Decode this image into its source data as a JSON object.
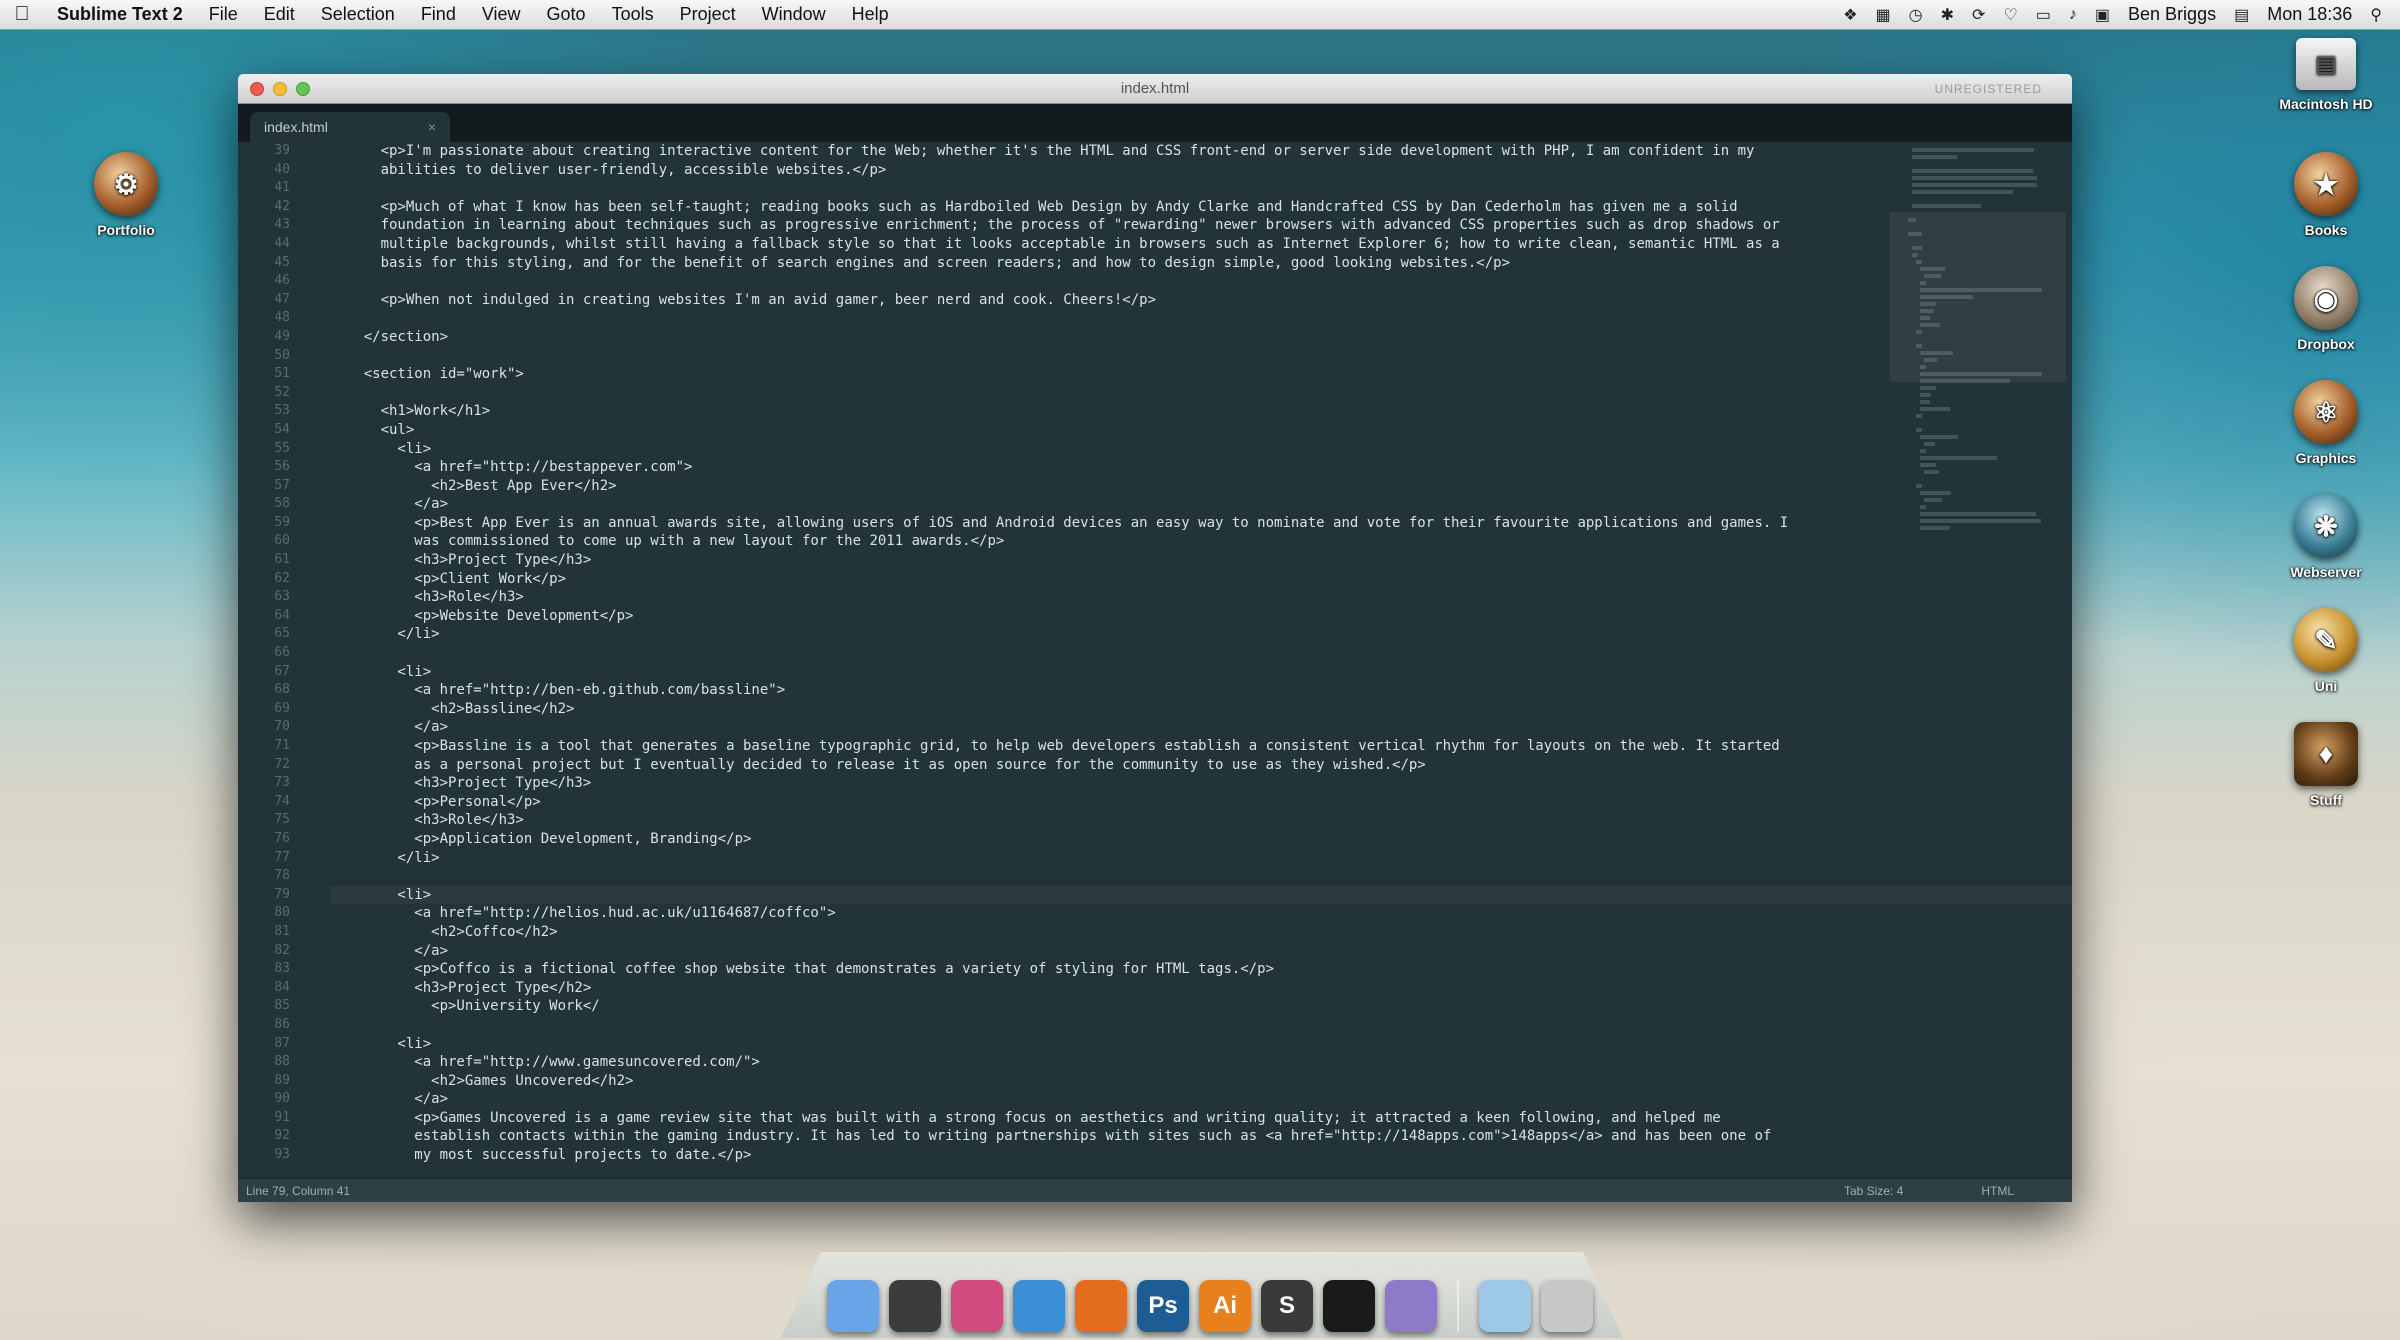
{
  "menubar": {
    "app_name": "Sublime Text 2",
    "items": [
      "File",
      "Edit",
      "Selection",
      "Find",
      "View",
      "Goto",
      "Tools",
      "Project",
      "Window",
      "Help"
    ],
    "user": "Ben Briggs",
    "clock": "Mon 18:36"
  },
  "desktop": {
    "left_icons": [
      {
        "label": "Portfolio",
        "icon": "portfolio-folder-icon"
      }
    ],
    "right_icons": [
      {
        "label": "Macintosh HD",
        "icon": "hard-drive-icon"
      },
      {
        "label": "Books",
        "icon": "books-folder-icon"
      },
      {
        "label": "Dropbox",
        "icon": "dropbox-folder-icon"
      },
      {
        "label": "Graphics",
        "icon": "graphics-folder-icon"
      },
      {
        "label": "Webserver",
        "icon": "webserver-folder-icon"
      },
      {
        "label": "Uni",
        "icon": "uni-folder-icon"
      },
      {
        "label": "Stuff",
        "icon": "stuff-folder-icon"
      }
    ]
  },
  "window": {
    "title": "index.html",
    "registration": "UNREGISTERED",
    "tab_label": "index.html",
    "gutter_start": 39,
    "current_line": 79,
    "code_lines": [
      "      <p>I'm passionate about creating interactive content for the Web; whether it's the HTML and CSS front-end or server side development with PHP, I am confident in my",
      "      abilities to deliver user-friendly, accessible websites.</p>",
      "",
      "      <p>Much of what I know has been self-taught; reading books such as Hardboiled Web Design by Andy Clarke and Handcrafted CSS by Dan Cederholm has given me a solid",
      "      foundation in learning about techniques such as progressive enrichment; the process of \"rewarding\" newer browsers with advanced CSS properties such as drop shadows or",
      "      multiple backgrounds, whilst still having a fallback style so that it looks acceptable in browsers such as Internet Explorer 6; how to write clean, semantic HTML as a",
      "      basis for this styling, and for the benefit of search engines and screen readers; and how to design simple, good looking websites.</p>",
      "",
      "      <p>When not indulged in creating websites I'm an avid gamer, beer nerd and cook. Cheers!</p>",
      "",
      "    </section>",
      "",
      "    <section id=\"work\">",
      "",
      "      <h1>Work</h1>",
      "      <ul>",
      "        <li>",
      "          <a href=\"http://bestappever.com\">",
      "            <h2>Best App Ever</h2>",
      "          </a>",
      "          <p>Best App Ever is an annual awards site, allowing users of iOS and Android devices an easy way to nominate and vote for their favourite applications and games. I",
      "          was commissioned to come up with a new layout for the 2011 awards.</p>",
      "          <h3>Project Type</h3>",
      "          <p>Client Work</p>",
      "          <h3>Role</h3>",
      "          <p>Website Development</p>",
      "        </li>",
      "",
      "        <li>",
      "          <a href=\"http://ben-eb.github.com/bassline\">",
      "            <h2>Bassline</h2>",
      "          </a>",
      "          <p>Bassline is a tool that generates a baseline typographic grid, to help web developers establish a consistent vertical rhythm for layouts on the web. It started",
      "          as a personal project but I eventually decided to release it as open source for the community to use as they wished.</p>",
      "          <h3>Project Type</h3>",
      "          <p>Personal</p>",
      "          <h3>Role</h3>",
      "          <p>Application Development, Branding</p>",
      "        </li>",
      "",
      "        <li>",
      "          <a href=\"http://helios.hud.ac.uk/u1164687/coffco\">",
      "            <h2>Coffco</h2>",
      "          </a>",
      "          <p>Coffco is a fictional coffee shop website that demonstrates a variety of styling for HTML tags.</p>",
      "          <h3>Project Type</h2>",
      "            <p>University Work</",
      "",
      "        <li>",
      "          <a href=\"http://www.gamesuncovered.com/\">",
      "            <h2>Games Uncovered</h2>",
      "          </a>",
      "          <p>Games Uncovered is a game review site that was built with a strong focus on aesthetics and writing quality; it attracted a keen following, and helped me",
      "          establish contacts within the gaming industry. It has led to writing partnerships with sites such as <a href=\"http://148apps.com\">148apps</a> and has been one of",
      "          my most successful projects to date.</p>"
    ],
    "status_left": "Line 79, Column 41",
    "status_tabsize": "Tab Size: 4",
    "status_syntax": "HTML"
  },
  "dock": {
    "apps": [
      {
        "name": "Finder",
        "label": "",
        "color": "#6aa4e8"
      },
      {
        "name": "Launchpad",
        "label": "",
        "color": "#3c3c3c"
      },
      {
        "name": "Photo Booth",
        "label": "",
        "color": "#d04b7e"
      },
      {
        "name": "Safari",
        "label": "",
        "color": "#3b8fd6"
      },
      {
        "name": "Firefox",
        "label": "",
        "color": "#e46c1f"
      },
      {
        "name": "Photoshop",
        "label": "Ps",
        "color": "#1d5d93"
      },
      {
        "name": "Illustrator",
        "label": "Ai",
        "color": "#e8801c"
      },
      {
        "name": "Sublime Text",
        "label": "S",
        "color": "#3a3a3a"
      },
      {
        "name": "Terminal",
        "label": "",
        "color": "#1a1a1a"
      },
      {
        "name": "Archive",
        "label": "",
        "color": "#8d7bc8"
      }
    ],
    "stack_items": [
      {
        "name": "Downloads",
        "color": "#9ec8e8"
      },
      {
        "name": "Trash",
        "color": "#c8c8c8"
      }
    ]
  }
}
